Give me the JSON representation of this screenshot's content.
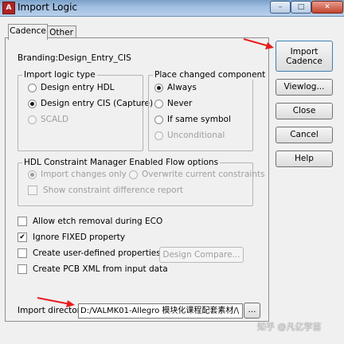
{
  "window": {
    "title": "Import Logic",
    "icon": "app-icon",
    "controls": [
      "minimize-icon",
      "maximize-icon",
      "close-icon"
    ]
  },
  "tabs": [
    {
      "label": "Cadence",
      "active": true
    },
    {
      "label": "Other",
      "active": false
    }
  ],
  "branding": {
    "label": "Branding:",
    "value": "Design_Entry_CIS"
  },
  "import_logic_type": {
    "title": "Import logic type",
    "options": [
      {
        "label": "Design entry HDL",
        "selected": false,
        "enabled": true
      },
      {
        "label": "Design entry CIS (Capture)",
        "selected": true,
        "enabled": true
      },
      {
        "label": "SCALD",
        "selected": false,
        "enabled": false
      }
    ]
  },
  "place_changed_component": {
    "title": "Place changed component",
    "options": [
      {
        "label": "Always",
        "selected": true,
        "enabled": true
      },
      {
        "label": "Never",
        "selected": false,
        "enabled": true
      },
      {
        "label": "If same symbol",
        "selected": false,
        "enabled": true
      },
      {
        "label": "Unconditional",
        "selected": false,
        "enabled": false
      }
    ]
  },
  "hdl_constraint": {
    "title": "HDL Constraint Manager Enabled Flow options",
    "radio_import_changes": "Import changes only",
    "radio_overwrite": "Overwrite current constraints",
    "check_show_diff": "Show constraint difference report"
  },
  "checkboxes": [
    {
      "label": "Allow etch removal during ECO",
      "checked": false
    },
    {
      "label": "Ignore FIXED property",
      "checked": true
    },
    {
      "label": "Create user-defined properties",
      "checked": false
    },
    {
      "label": "Create PCB XML from input data",
      "checked": false
    }
  ],
  "design_compare_label": "Design Compare...",
  "import_directory": {
    "label": "Import directory:",
    "value": "D:/VALMK01-Allegro 模块化课程配套素材/\\",
    "browse_label": "..."
  },
  "side_buttons": {
    "import_cadence": "Import\nCadence",
    "viewlog": "Viewlog...",
    "close": "Close",
    "cancel": "Cancel",
    "help": "Help"
  },
  "annotation_color": "#e81e1e",
  "watermark": "知乎 @凡亿学苗"
}
